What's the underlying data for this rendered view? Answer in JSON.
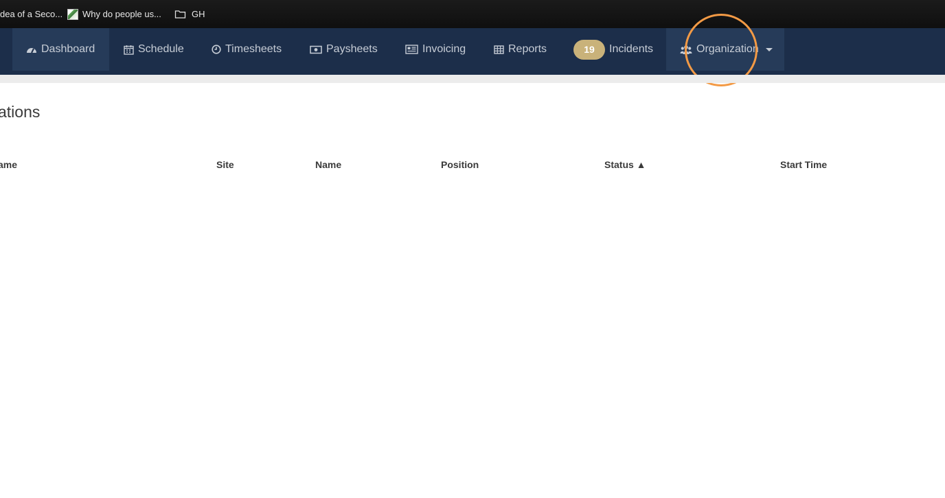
{
  "bookmarks": [
    {
      "label": "dea of a Seco...",
      "icon": "favicon-partial"
    },
    {
      "label": "Why do people us...",
      "icon": "site-favicon"
    },
    {
      "label": "GH",
      "icon": "folder-icon"
    }
  ],
  "nav": {
    "dashboard": "Dashboard",
    "schedule": "Schedule",
    "timesheets": "Timesheets",
    "paysheets": "Paysheets",
    "invoicing": "Invoicing",
    "reports": "Reports",
    "incidents_count": "19",
    "incidents": "Incidents",
    "organization": "Organization"
  },
  "page": {
    "title": "ations"
  },
  "table": {
    "columns": [
      "ame",
      "Site",
      "Name",
      "Position",
      "Status ▲",
      "Start Time"
    ]
  },
  "colors": {
    "navbar": "#1c2e4a",
    "badge": "#c9b27a",
    "highlight": "#f39a45"
  }
}
